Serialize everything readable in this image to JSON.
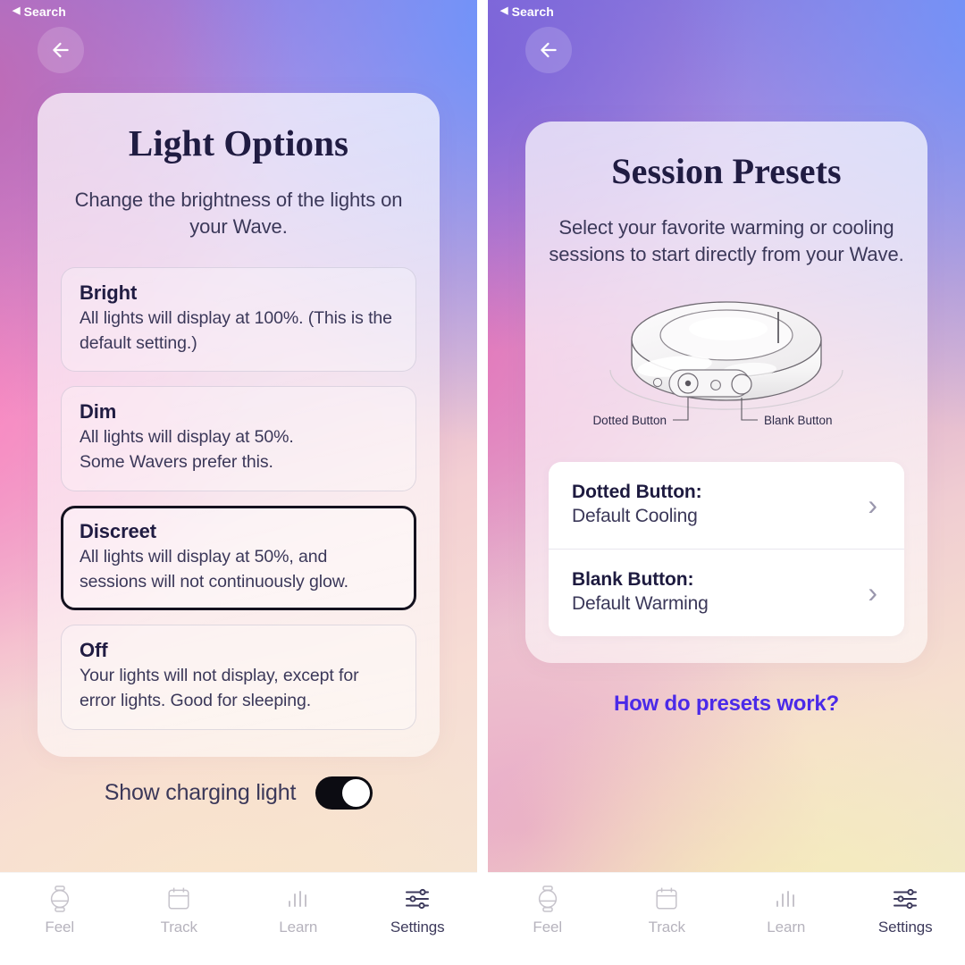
{
  "theme": {
    "accent_link": "#4b2ae8",
    "text_dark": "#201c42",
    "text_body": "#3b3859",
    "selected_border": "#14121f",
    "tab_inactive": "#b6b3bd",
    "tab_active": "#3d3a5c"
  },
  "left": {
    "statusbar": {
      "back_label": "Search",
      "back_glyph": "◀"
    },
    "back_button": "back-arrow",
    "title": "Light Options",
    "subtitle": "Change the brightness of the lights on your Wave.",
    "options": [
      {
        "title": "Bright",
        "desc": "All lights will display at 100%. (This is the default setting.)",
        "selected": false
      },
      {
        "title": "Dim",
        "desc": "All lights will display at 50%.\nSome Wavers prefer this.",
        "selected": false
      },
      {
        "title": "Discreet",
        "desc": "All lights will display at 50%, and sessions will not continuously glow.",
        "selected": true
      },
      {
        "title": "Off",
        "desc": "Your lights will not display, except for error lights. Good for sleeping.",
        "selected": false
      }
    ],
    "toggle": {
      "label": "Show charging light",
      "state": "on"
    },
    "tabs": [
      {
        "label": "Feel",
        "icon": "watch-icon",
        "active": false
      },
      {
        "label": "Track",
        "icon": "calendar-icon",
        "active": false
      },
      {
        "label": "Learn",
        "icon": "bars-icon",
        "active": false
      },
      {
        "label": "Settings",
        "icon": "sliders-icon",
        "active": true
      }
    ]
  },
  "right": {
    "statusbar": {
      "back_label": "Search",
      "back_glyph": "◀"
    },
    "back_button": "back-arrow",
    "title": "Session Presets",
    "subtitle": "Select your favorite warming or cooling sessions to start directly from your Wave.",
    "diagram": {
      "name": "wave-device-diagram",
      "labels": [
        {
          "text": "Dotted Button"
        },
        {
          "text": "Blank Button"
        }
      ]
    },
    "presets": [
      {
        "title": "Dotted Button:",
        "value": "Default Cooling",
        "chevron": "›"
      },
      {
        "title": "Blank Button:",
        "value": "Default Warming",
        "chevron": "›"
      }
    ],
    "help_link": "How do presets work?",
    "tabs": [
      {
        "label": "Feel",
        "icon": "watch-icon",
        "active": false
      },
      {
        "label": "Track",
        "icon": "calendar-icon",
        "active": false
      },
      {
        "label": "Learn",
        "icon": "bars-icon",
        "active": false
      },
      {
        "label": "Settings",
        "icon": "sliders-icon",
        "active": true
      }
    ]
  }
}
